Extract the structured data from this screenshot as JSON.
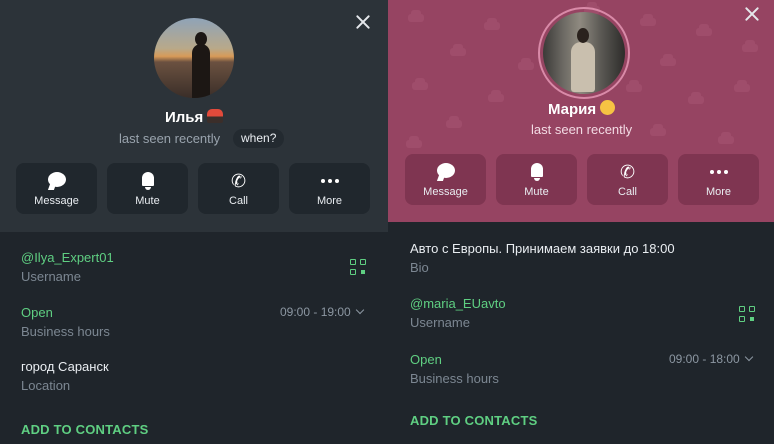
{
  "colors": {
    "accent_green": "#5fcf82",
    "left_header_bg": "#2c3339",
    "right_header_bg": "#964462",
    "panel_bg": "#1f252b"
  },
  "left_profile": {
    "name": "Илья",
    "name_emoji": "car-emoji",
    "last_seen": "last seen recently",
    "when_label": "when?",
    "actions": [
      {
        "label": "Message",
        "icon": "message-icon"
      },
      {
        "label": "Mute",
        "icon": "bell-icon"
      },
      {
        "label": "Call",
        "icon": "phone-icon"
      },
      {
        "label": "More",
        "icon": "more-icon"
      }
    ],
    "username": {
      "value": "@Ilya_Expert01",
      "label": "Username"
    },
    "business_hours": {
      "status": "Open",
      "label": "Business hours",
      "hours": "09:00 - 19:00"
    },
    "location": {
      "value": "город Саранск",
      "label": "Location"
    },
    "add_contacts": "ADD TO CONTACTS"
  },
  "right_profile": {
    "name": "Мария",
    "name_emoji": "chick-emoji",
    "last_seen": "last seen recently",
    "actions": [
      {
        "label": "Message",
        "icon": "message-icon"
      },
      {
        "label": "Mute",
        "icon": "bell-icon"
      },
      {
        "label": "Call",
        "icon": "phone-icon"
      },
      {
        "label": "More",
        "icon": "more-icon"
      }
    ],
    "bio": {
      "value": "Авто с Европы. Принимаем заявки до 18:00",
      "label": "Bio"
    },
    "username": {
      "value": "@maria_EUavto",
      "label": "Username"
    },
    "business_hours": {
      "status": "Open",
      "label": "Business hours",
      "hours": "09:00 - 18:00"
    },
    "add_contacts": "ADD TO CONTACTS"
  }
}
